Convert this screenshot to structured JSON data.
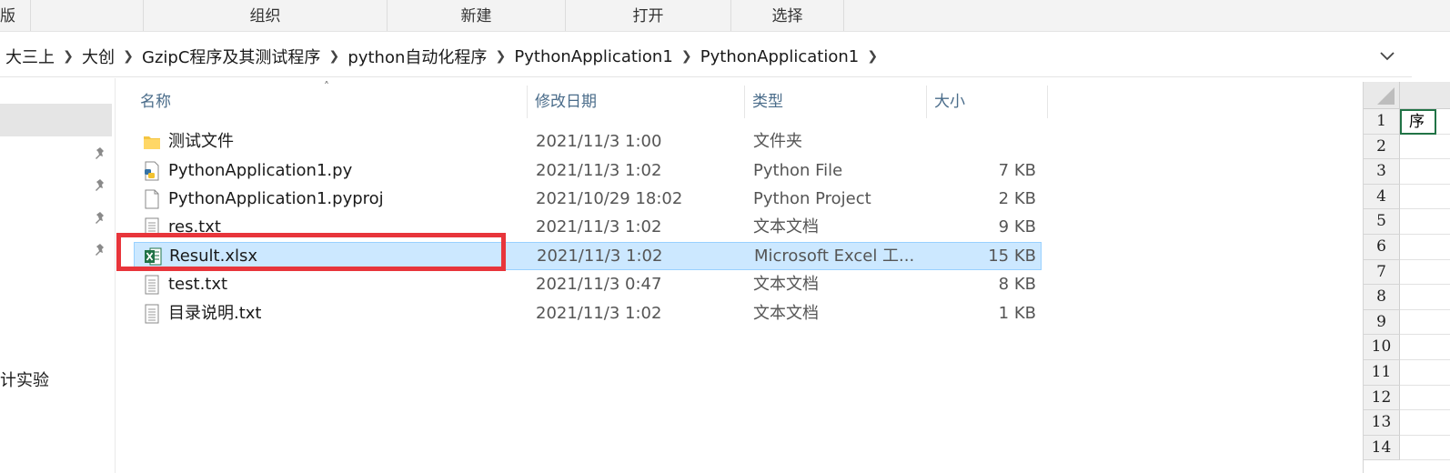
{
  "ribbon": {
    "groups": [
      {
        "label": "版"
      },
      {
        "label": ""
      },
      {
        "label": "组织"
      },
      {
        "label": "新建"
      },
      {
        "label": "打开"
      },
      {
        "label": "选择"
      }
    ]
  },
  "breadcrumb": {
    "items": [
      "大三上",
      "大创",
      "GzipC程序及其测试程序",
      "python自动化程序",
      "PythonApplication1",
      "PythonApplication1"
    ]
  },
  "nav": {
    "visible_label": "计实验"
  },
  "columns": {
    "name": "名称",
    "date": "修改日期",
    "type": "类型",
    "size": "大小"
  },
  "files": [
    {
      "name": "测试文件",
      "date": "2021/11/3 1:00",
      "type": "文件夹",
      "size": "",
      "icon": "folder-icon"
    },
    {
      "name": "PythonApplication1.py",
      "date": "2021/11/3 1:02",
      "type": "Python File",
      "size": "7 KB",
      "icon": "python-file-icon"
    },
    {
      "name": "PythonApplication1.pyproj",
      "date": "2021/10/29 18:02",
      "type": "Python Project",
      "size": "2 KB",
      "icon": "blank-file-icon"
    },
    {
      "name": "res.txt",
      "date": "2021/11/3 1:02",
      "type": "文本文档",
      "size": "9 KB",
      "icon": "text-file-icon"
    },
    {
      "name": "Result.xlsx",
      "date": "2021/11/3 1:02",
      "type": "Microsoft Excel 工...",
      "size": "15 KB",
      "icon": "excel-file-icon",
      "selected": true
    },
    {
      "name": "test.txt",
      "date": "2021/11/3 0:47",
      "type": "文本文档",
      "size": "8 KB",
      "icon": "text-file-icon"
    },
    {
      "name": "目录说明.txt",
      "date": "2021/11/3 1:02",
      "type": "文本文档",
      "size": "1 KB",
      "icon": "text-file-icon"
    }
  ],
  "excel": {
    "active_cell_text": "序",
    "row_numbers": [
      "1",
      "2",
      "3",
      "4",
      "5",
      "6",
      "7",
      "8",
      "9",
      "10",
      "11",
      "12",
      "13",
      "14"
    ]
  },
  "colors": {
    "selection": "#cce8ff",
    "highlight_box": "#e8353b",
    "excel_green": "#217346"
  }
}
